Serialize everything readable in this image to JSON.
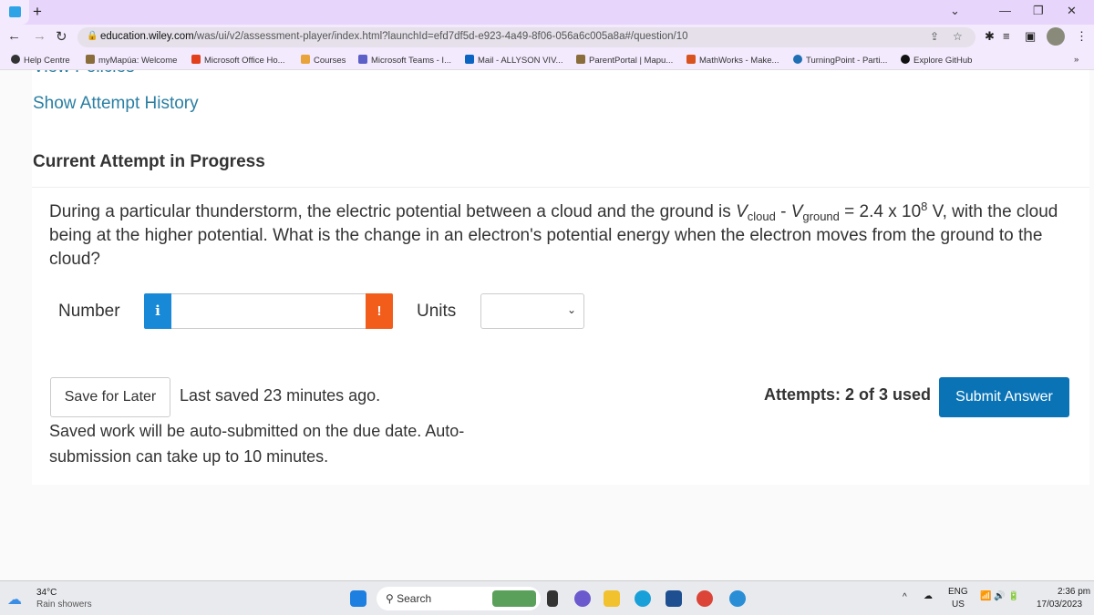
{
  "browser": {
    "new_tab": "+",
    "url_host": "education.wiley.com",
    "url_path": "/was/ui/v2/assessment-player/index.html?launchId=efd7df5d-e923-4a49-8f06-056a6c005a8a#/question/10",
    "bookmarks": [
      {
        "label": "Help Centre",
        "color": "#333333"
      },
      {
        "label": "myMapúa: Welcome",
        "color": "#8a6d3b"
      },
      {
        "label": "Microsoft Office Ho...",
        "color": "#e2401c"
      },
      {
        "label": "Courses",
        "color": "#e8a33a"
      },
      {
        "label": "Microsoft Teams - I...",
        "color": "#5b5fc7"
      },
      {
        "label": "Mail - ALLYSON VIV...",
        "color": "#0a64c2"
      },
      {
        "label": "ParentPortal | Mapu...",
        "color": "#8a6d3b"
      },
      {
        "label": "MathWorks - Make...",
        "color": "#d9531e"
      },
      {
        "label": "TurningPoint - Parti...",
        "color": "#1f6fb5"
      },
      {
        "label": "Explore GitHub",
        "color": "#111111"
      }
    ],
    "more": "»"
  },
  "page": {
    "view_policies": "View Policies",
    "show_history": "Show Attempt History",
    "heading": "Current Attempt in Progress",
    "question": {
      "p1": "During a particular thunderstorm, the electric potential between a cloud and the ground is ",
      "v": "V",
      "sub1": "cloud",
      "minus": " - ",
      "sub2": "ground",
      "p2": " = 2.4 x 10",
      "exp": "8",
      "p3": " V, with the cloud being at the higher potential. What is the change in an electron's potential energy when the electron moves from the ground to the cloud?"
    },
    "number_label": "Number",
    "number_value": "",
    "units_label": "Units",
    "units_value": "",
    "save_label": "Save for Later",
    "last_saved": "Last saved 23 minutes ago.",
    "auto_submit": "Saved work will be auto-submitted on the due date. Auto-submission can take up to 10 minutes.",
    "attempts": "Attempts: 2 of 3 used",
    "submit_label": "Submit Answer",
    "colors": {
      "link": "#2b7fa3",
      "info": "#1789d6",
      "warning": "#f25d1c",
      "submit": "#0a73b6"
    }
  },
  "taskbar": {
    "temp": "34°C",
    "weather": "Rain showers",
    "search": "Search",
    "lang1": "ENG",
    "lang2": "US",
    "time": "2:36 pm",
    "date": "17/03/2023"
  }
}
